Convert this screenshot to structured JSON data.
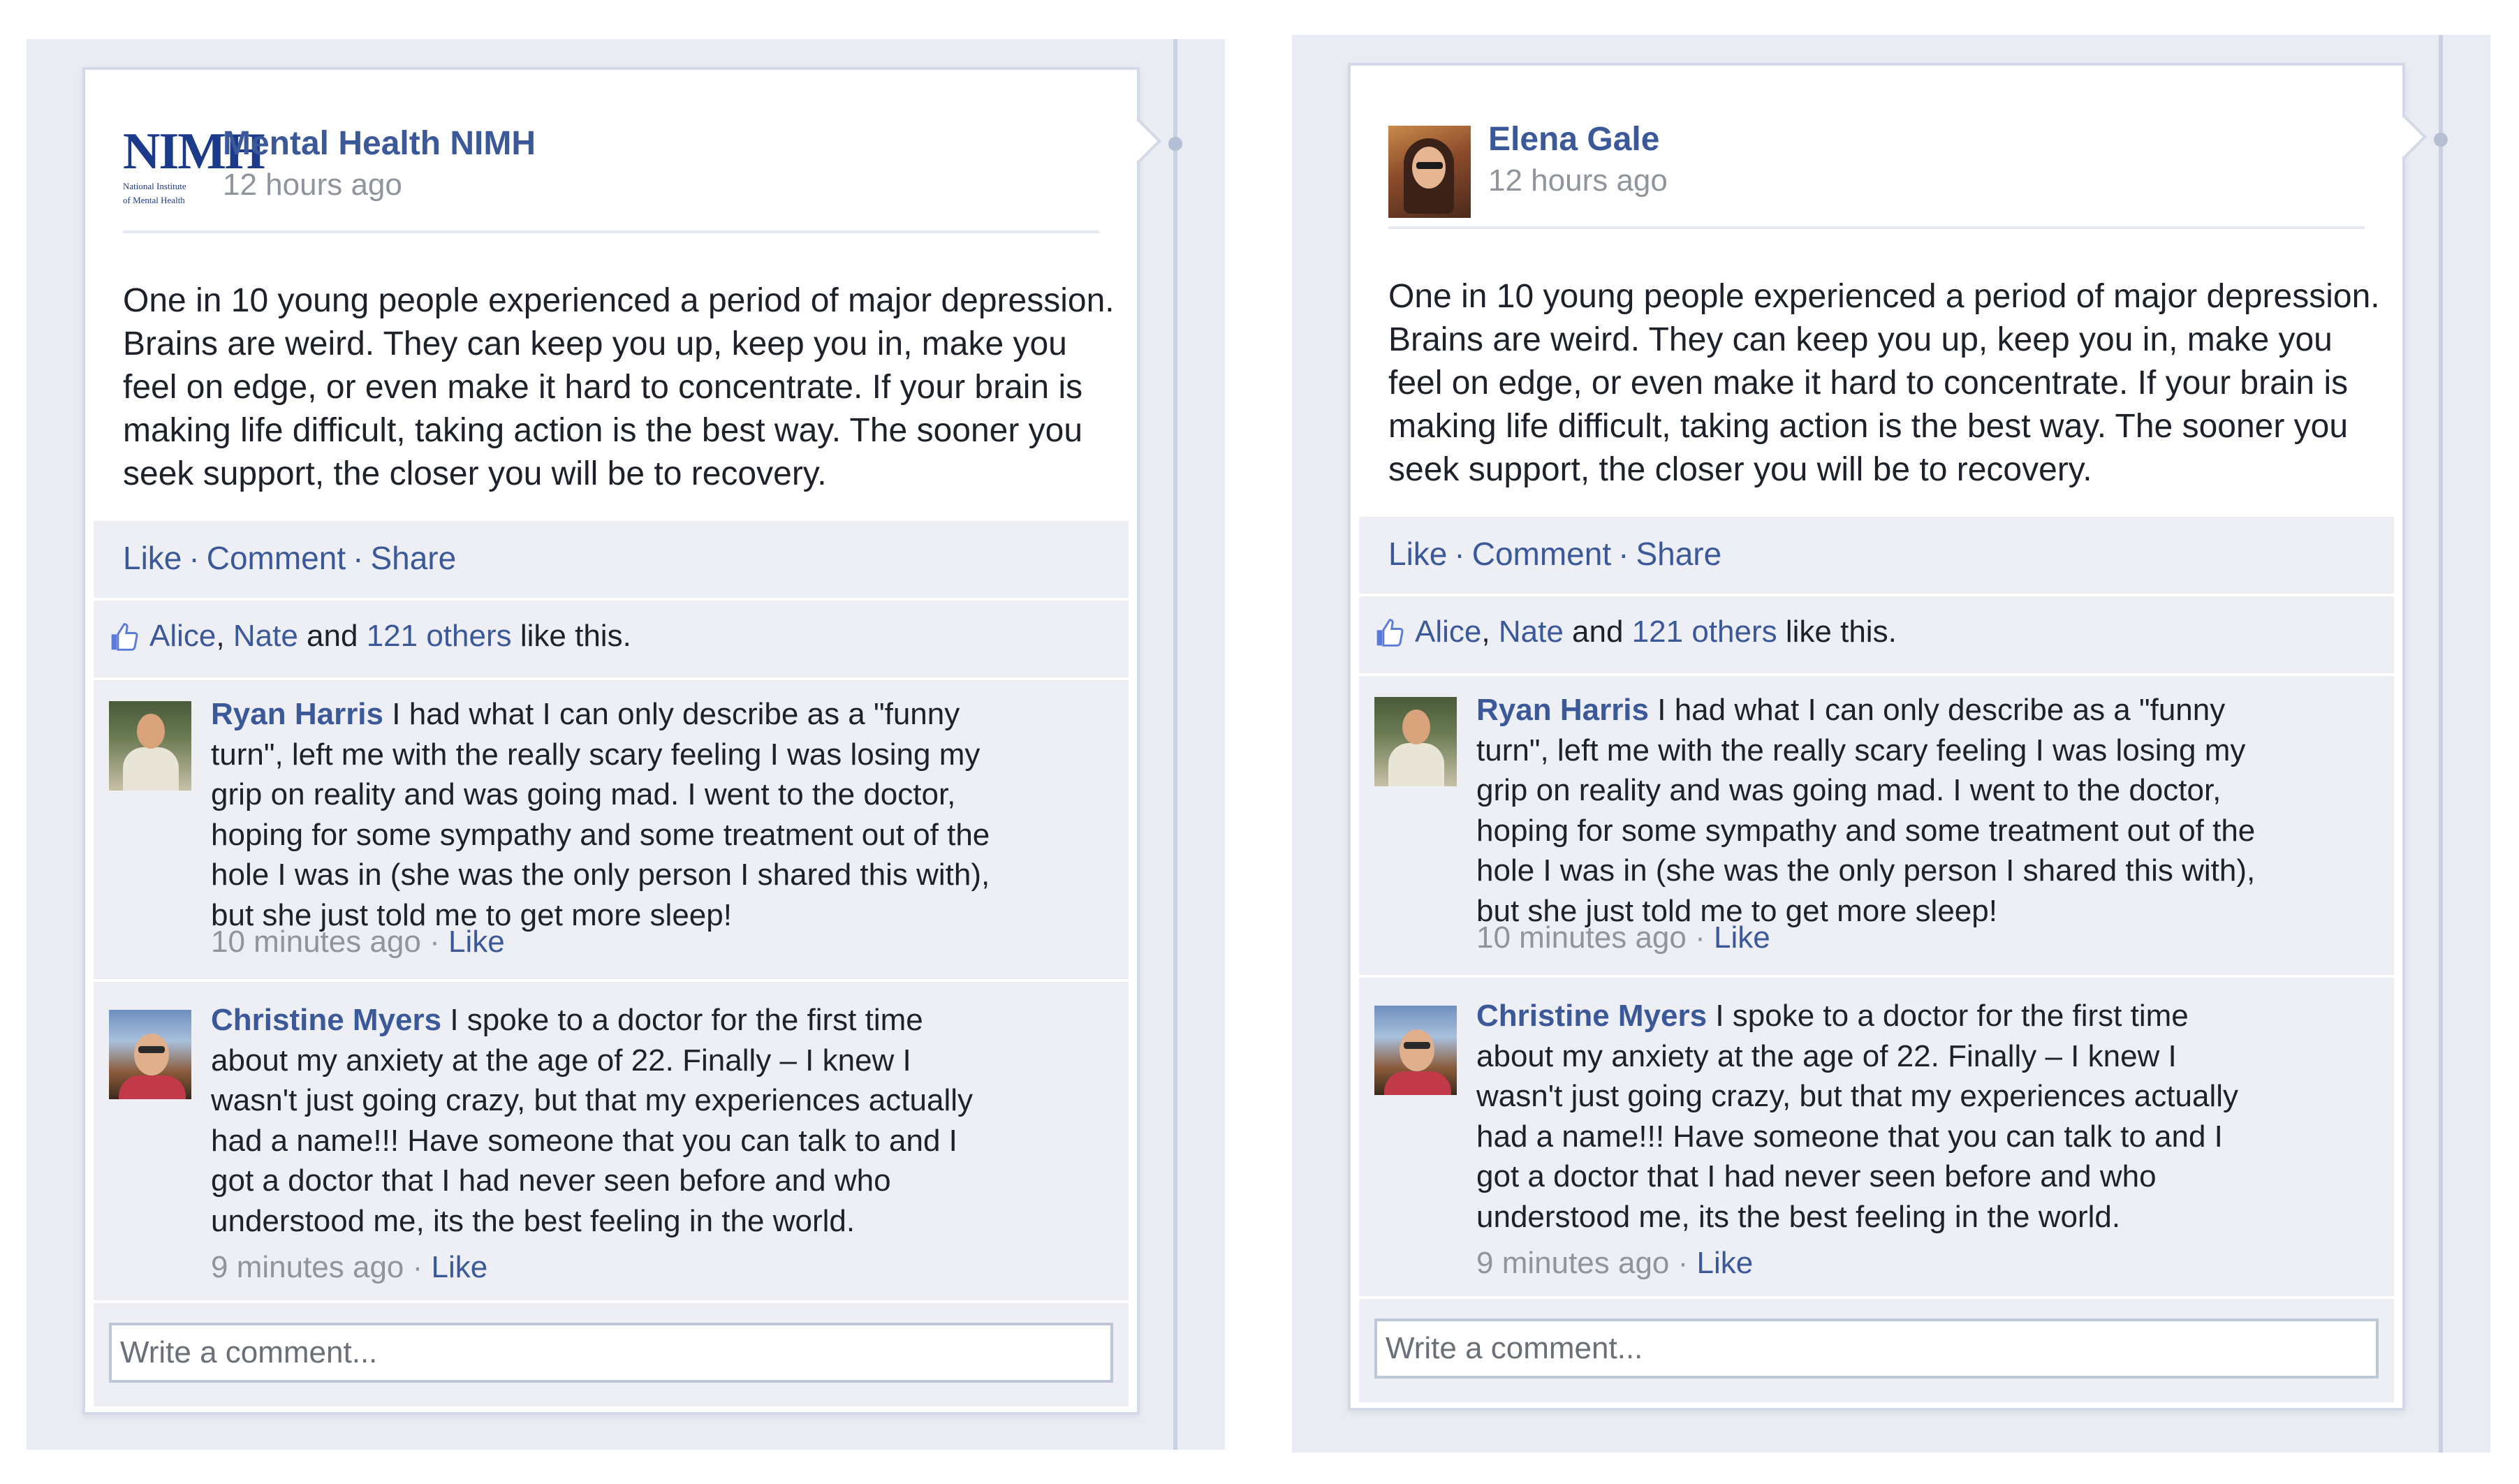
{
  "posts": [
    {
      "author": "Mental Health NIMH",
      "avatar": {
        "logo_text": "NIMH",
        "logo_subtitle_line1": "National Institute",
        "logo_subtitle_line2": "of Mental Health"
      },
      "time": "12 hours ago",
      "body": "One in 10 young people experienced a period of major depression. Brains are weird. They can keep you up, keep you in, make you feel on edge, or even make it hard to concentrate. If your brain is making life difficult, taking action is the best way. The sooner you seek support, the closer you will be to recovery.",
      "actions": {
        "like": "Like",
        "comment": "Comment",
        "share": "Share",
        "separator": "·"
      },
      "likes": {
        "name1": "Alice",
        "comma": ",",
        "name2": "Nate",
        "and": "and",
        "others": "121 others",
        "suffix": "like this."
      },
      "comments": [
        {
          "name": "Ryan Harris",
          "text": "I had what I can only describe as a \"funny turn\", left me with the really scary feeling I was losing my grip on reality and was going mad. I went to the doctor, hoping for some sympathy and some treatment out of the hole I was in (she was the only person I shared this with), but she just told me to get more sleep!",
          "time": "10 minutes ago",
          "like": "Like"
        },
        {
          "name": "Christine Myers",
          "text": "I spoke to a doctor for the first time about my anxiety at the age of 22. Finally – I knew I wasn't just going crazy, but that my experiences actually had a name!!! Have someone that you can talk to and I got a doctor that I had never seen before and who understood me, its the best feeling in the world.",
          "time": "9 minutes ago",
          "like": "Like"
        }
      ],
      "composer_placeholder": "Write a comment..."
    },
    {
      "author": "Elena Gale",
      "time": "12 hours ago",
      "body": "One in 10 young people experienced a period of major depression. Brains are weird. They can keep you up, keep you in, make you feel on edge, or even make it hard to concentrate. If your brain is making life difficult, taking action is the best way. The sooner you seek support, the closer you will be to recovery.",
      "actions": {
        "like": "Like",
        "comment": "Comment",
        "share": "Share",
        "separator": "·"
      },
      "likes": {
        "name1": "Alice",
        "comma": ",",
        "name2": "Nate",
        "and": "and",
        "others": "121 others",
        "suffix": "like this."
      },
      "comments": [
        {
          "name": "Ryan Harris",
          "text": "I had what I can only describe as a \"funny turn\", left me with the really scary feeling I was losing my grip on reality and was going mad. I went to the doctor, hoping for some sympathy and some treatment out of the hole I was in (she was the only person I shared this with), but she just told me to get more sleep!",
          "time": "10 minutes ago",
          "like": "Like"
        },
        {
          "name": "Christine Myers",
          "text": "I spoke to a doctor for the first time about my anxiety at the age of 22. Finally – I knew I wasn't just going crazy, but that my experiences actually had a name!!! Have someone that you can talk to and I got a doctor that I had never seen before and who understood me, its the best feeling in the world.",
          "time": "9 minutes ago",
          "like": "Like"
        }
      ],
      "composer_placeholder": "Write a comment..."
    }
  ],
  "colors": {
    "link_blue": "#3b5998",
    "meta_grey": "#90949c",
    "section_grey": "#edeff4",
    "panel_bg": "#e9ecf3",
    "text": "#1d2129"
  },
  "icons": {
    "likes": "thumbs-up-icon"
  }
}
